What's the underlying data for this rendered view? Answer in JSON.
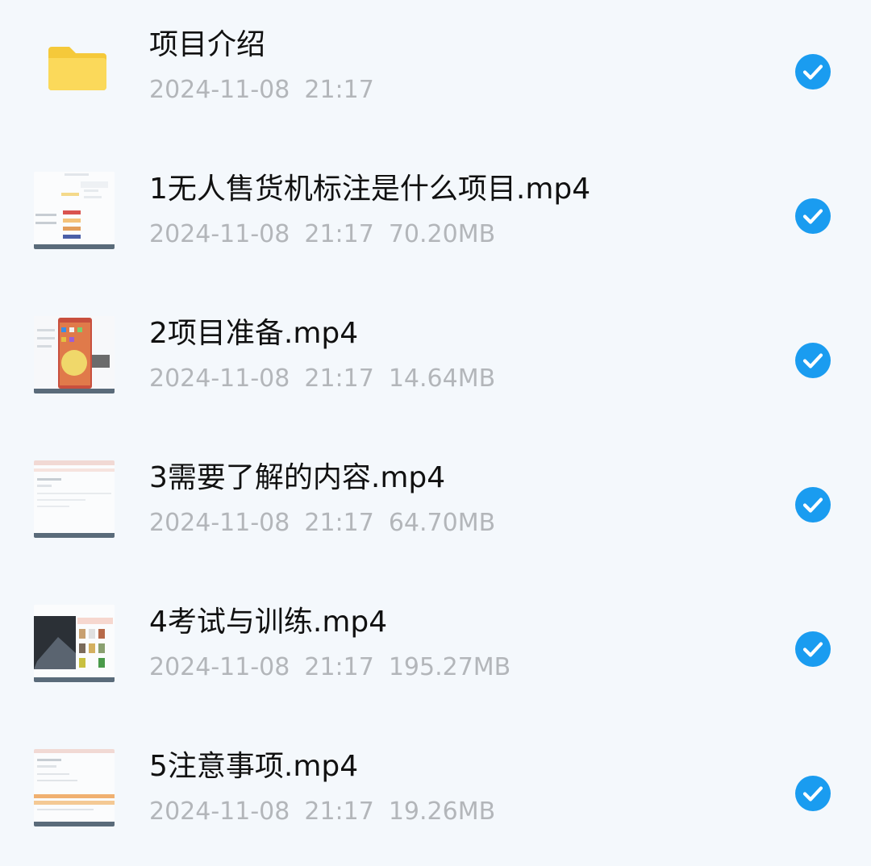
{
  "colors": {
    "background": "#f4f8fc",
    "accent": "#1a9cf0",
    "folder": "#f8d24b",
    "meta_text": "#b3b6ba"
  },
  "files": [
    {
      "type": "folder",
      "icon": "folder-icon",
      "name": "项目介绍",
      "date": "2024-11-08",
      "time": "21:17",
      "size": "",
      "selected": true
    },
    {
      "type": "video",
      "icon": "video-thumbnail",
      "name": "1无人售货机标注是什么项目.mp4",
      "date": "2024-11-08",
      "time": "21:17",
      "size": "70.20MB",
      "selected": true
    },
    {
      "type": "video",
      "icon": "video-thumbnail",
      "name": "2项目准备.mp4",
      "date": "2024-11-08",
      "time": "21:17",
      "size": "14.64MB",
      "selected": true
    },
    {
      "type": "video",
      "icon": "video-thumbnail",
      "name": "3需要了解的内容.mp4",
      "date": "2024-11-08",
      "time": "21:17",
      "size": "64.70MB",
      "selected": true
    },
    {
      "type": "video",
      "icon": "video-thumbnail",
      "name": "4考试与训练.mp4",
      "date": "2024-11-08",
      "time": "21:17",
      "size": "195.27MB",
      "selected": true
    },
    {
      "type": "video",
      "icon": "video-thumbnail",
      "name": "5注意事项.mp4",
      "date": "2024-11-08",
      "time": "21:17",
      "size": "19.26MB",
      "selected": true
    }
  ]
}
